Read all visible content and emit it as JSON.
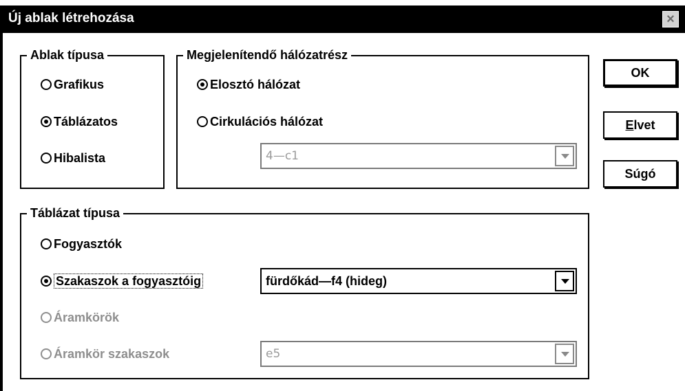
{
  "window": {
    "title": "Új ablak létrehozása",
    "close_symbol": "×"
  },
  "ablak_tipusa": {
    "legend": "Ablak típusa",
    "options": [
      {
        "label": "Grafikus",
        "checked": false
      },
      {
        "label": "Táblázatos",
        "checked": true
      },
      {
        "label": "Hibalista",
        "checked": false
      }
    ]
  },
  "halozatresz": {
    "legend": "Megjelenítendő hálózatrész",
    "options": [
      {
        "label": "Elosztó hálózat",
        "checked": true
      },
      {
        "label": "Cirkulációs hálózat",
        "checked": false
      }
    ],
    "combo_value": "4—c1",
    "combo_enabled": false
  },
  "tablazat_tipusa": {
    "legend": "Táblázat típusa",
    "options": [
      {
        "label": "Fogyasztók",
        "checked": false,
        "enabled": true
      },
      {
        "label": "Szakaszok a fogyasztóig",
        "checked": true,
        "enabled": true
      },
      {
        "label": "Áramkörök",
        "checked": false,
        "enabled": false
      },
      {
        "label": "Áramkör szakaszok",
        "checked": false,
        "enabled": false
      }
    ],
    "combo_szakaszok_value": "fürdőkád—f4 (hideg)",
    "combo_aramkor_value": "e5"
  },
  "buttons": {
    "ok": "OK",
    "elvet_first": "E",
    "elvet_rest": "lvet",
    "sugo": "Súgó"
  }
}
